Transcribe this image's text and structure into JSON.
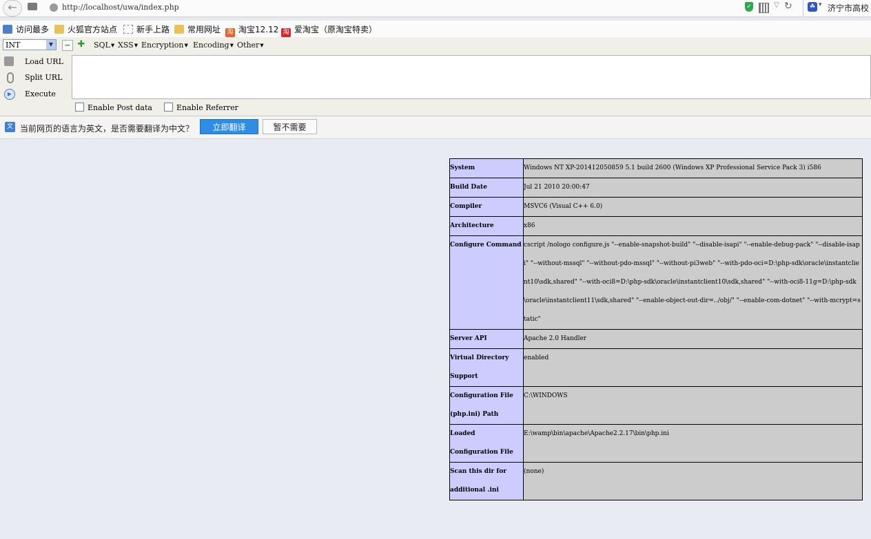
{
  "addressbar": {
    "url": "http://localhost/uwa/index.php",
    "search_engine_text": "济宁市高校"
  },
  "bookmarks": [
    {
      "label": "访问最多",
      "icon": "magnifier-icon"
    },
    {
      "label": "火狐官方站点",
      "icon": "folder-icon"
    },
    {
      "label": "新手上路",
      "icon": "dashed-box-icon"
    },
    {
      "label": "常用网址",
      "icon": "folder-icon"
    },
    {
      "label": "淘宝12.12",
      "icon": "taobao-icon"
    },
    {
      "label": "爱淘宝（原淘宝特卖）",
      "icon": "ai-taobao-icon"
    }
  ],
  "hackbar": {
    "type_select": "INT",
    "menus": [
      "SQL",
      "XSS",
      "Encryption",
      "Encoding",
      "Other"
    ],
    "actions": [
      "Load URL",
      "Split URL",
      "Execute"
    ],
    "url_value": "",
    "checkboxes": [
      "Enable Post data",
      "Enable Referrer"
    ]
  },
  "translate": {
    "message": "当前网页的语言为英文，是否需要翻译为中文？",
    "translate_button": "立即翻译",
    "dismiss_button": "暂不需要"
  },
  "phpinfo": {
    "rows": [
      {
        "key": "System",
        "value": "Windows NT XP-201412050859 5.1 build 2600 (Windows XP Professional Service Pack 3) i586"
      },
      {
        "key": "Build Date",
        "value": "Jul 21 2010 20:00:47"
      },
      {
        "key": "Compiler",
        "value": "MSVC6 (Visual C++ 6.0)"
      },
      {
        "key": "Architecture",
        "value": "x86"
      },
      {
        "key": "Configure Command",
        "value": "cscript /nologo configure.js \"--enable-snapshot-build\" \"--disable-isapi\" \"--enable-debug-pack\" \"--disable-isapi\" \"--without-mssql\" \"--without-pdo-mssql\" \"--without-pi3web\" \"--with-pdo-oci=D:\\php-sdk\\oracle\\instantclient10\\sdk,shared\" \"--with-oci8=D:\\php-sdk\\oracle\\instantclient10\\sdk,shared\" \"--with-oci8-11g=D:\\php-sdk\\oracle\\instantclient11\\sdk,shared\" \"--enable-object-out-dir=../obj/\" \"--enable-com-dotnet\" \"--with-mcrypt=static\""
      },
      {
        "key": "Server API",
        "value": "Apache 2.0 Handler"
      },
      {
        "key": "Virtual Directory Support",
        "value": "enabled"
      },
      {
        "key": "Configuration File (php.ini) Path",
        "value": "C:\\WINDOWS"
      },
      {
        "key": "Loaded Configuration File",
        "value": "E:\\wamp\\bin\\apache\\Apache2.2.17\\bin\\php.ini"
      },
      {
        "key": "Scan this dir for additional .ini",
        "value": "(none)"
      }
    ]
  }
}
